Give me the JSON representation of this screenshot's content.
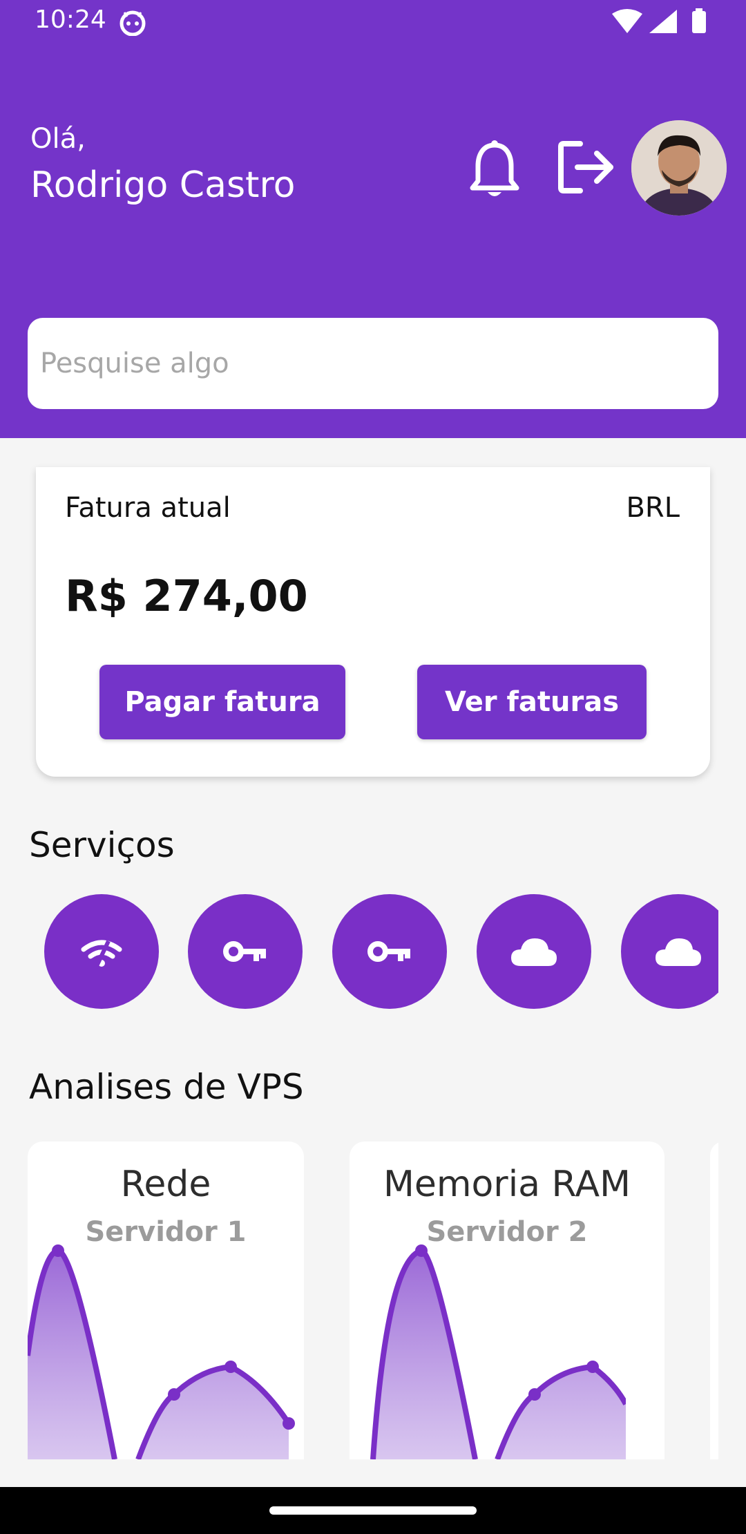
{
  "status_bar": {
    "time": "10:24",
    "icons": [
      "android-icon",
      "wifi-icon",
      "cellular-signal-icon",
      "battery-icon"
    ]
  },
  "header": {
    "greeting": "Olá,",
    "user_name": "Rodrigo Castro",
    "icons": [
      "bell-icon",
      "logout-icon"
    ],
    "background_color": "#7434c9"
  },
  "search": {
    "placeholder": "Pesquise algo"
  },
  "invoice": {
    "title": "Fatura atual",
    "currency": "BRL",
    "amount": "R$ 274,00",
    "pay_button": "Pagar fatura",
    "view_button": "Ver faturas"
  },
  "services": {
    "title": "Serviços",
    "items": [
      {
        "icon": "wifi-icon"
      },
      {
        "icon": "key-icon"
      },
      {
        "icon": "key-icon"
      },
      {
        "icon": "cloud-icon"
      },
      {
        "icon": "cloud-icon"
      }
    ]
  },
  "vps": {
    "title": "Analises de VPS",
    "cards": [
      {
        "name": "Rede",
        "server": "Servidor 1"
      },
      {
        "name": "Memoria RAM",
        "server": "Servidor 2"
      }
    ]
  },
  "accent_color": "#7434c9"
}
